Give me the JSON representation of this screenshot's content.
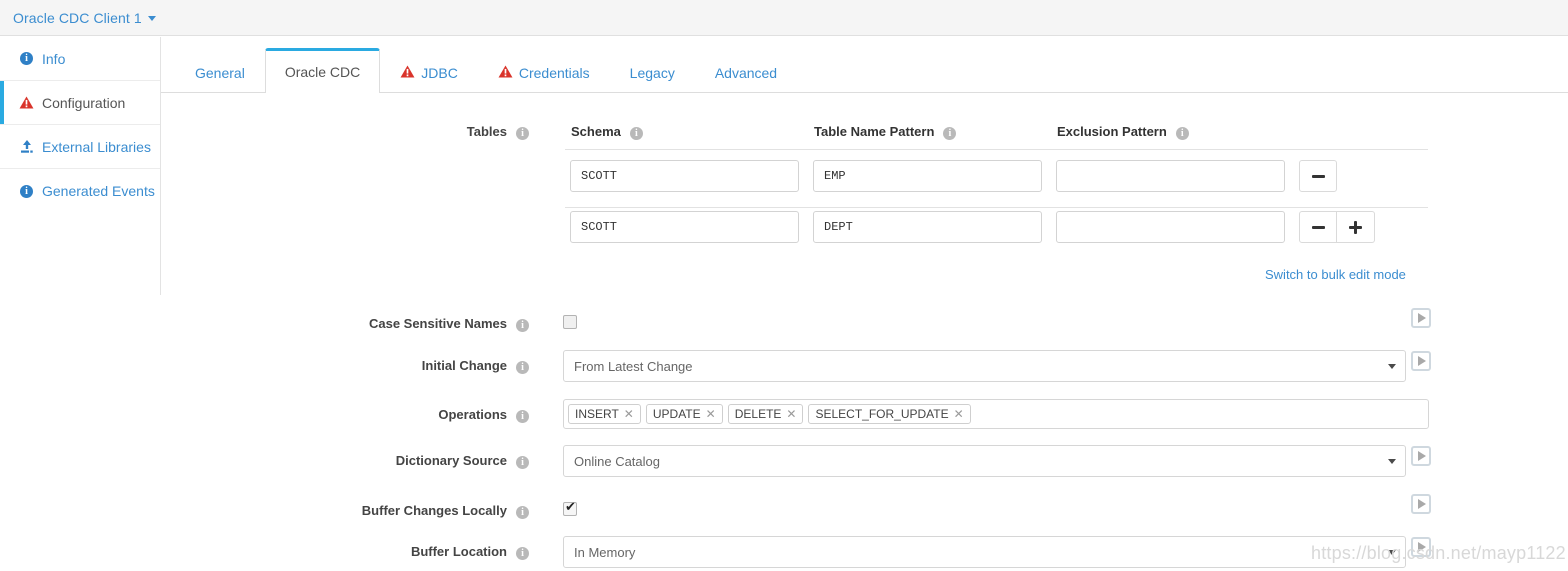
{
  "titlebar": {
    "title": "Oracle CDC Client 1",
    "caret_icon": "chevron-down-icon"
  },
  "sidebar": {
    "items": [
      {
        "label": "Info",
        "icon": "info-circle-icon",
        "active": false
      },
      {
        "label": "Configuration",
        "icon": "warning-triangle-icon",
        "active": true
      },
      {
        "label": "External Libraries",
        "icon": "upload-icon",
        "active": false
      },
      {
        "label": "Generated Events",
        "icon": "info-circle-icon",
        "active": false
      }
    ]
  },
  "tabs": [
    {
      "label": "General",
      "icon": null,
      "active": false
    },
    {
      "label": "Oracle CDC",
      "icon": null,
      "active": true
    },
    {
      "label": "JDBC",
      "icon": "warning-triangle-icon",
      "active": false
    },
    {
      "label": "Credentials",
      "icon": "warning-triangle-icon",
      "active": false
    },
    {
      "label": "Legacy",
      "icon": null,
      "active": false
    },
    {
      "label": "Advanced",
      "icon": null,
      "active": false
    }
  ],
  "form": {
    "tables": {
      "label": "Tables",
      "info_icon": "info-circle-icon",
      "columns": [
        {
          "label": "Schema",
          "info_icon": "info-circle-icon"
        },
        {
          "label": "Table Name Pattern",
          "info_icon": "info-circle-icon"
        },
        {
          "label": "Exclusion Pattern",
          "info_icon": "info-circle-icon"
        }
      ],
      "rows": [
        {
          "schema": "SCOTT",
          "table_name_pattern": "EMP",
          "exclusion_pattern": "",
          "buttons": [
            "minus"
          ]
        },
        {
          "schema": "SCOTT",
          "table_name_pattern": "DEPT",
          "exclusion_pattern": "",
          "buttons": [
            "minus",
            "plus"
          ]
        }
      ],
      "bulk_edit_link": "Switch to bulk edit mode"
    },
    "case_sensitive_names": {
      "label": "Case Sensitive Names",
      "info_icon": "info-circle-icon",
      "checked": false,
      "expand_icon": "play-expand-icon"
    },
    "initial_change": {
      "label": "Initial Change",
      "info_icon": "info-circle-icon",
      "value": "From Latest Change",
      "caret_icon": "chevron-down-icon",
      "expand_icon": "play-expand-icon"
    },
    "operations": {
      "label": "Operations",
      "info_icon": "info-circle-icon",
      "tags": [
        "INSERT",
        "UPDATE",
        "DELETE",
        "SELECT_FOR_UPDATE"
      ],
      "tag_remove_icon": "close-icon"
    },
    "dictionary_source": {
      "label": "Dictionary Source",
      "info_icon": "info-circle-icon",
      "value": "Online Catalog",
      "caret_icon": "chevron-down-icon",
      "expand_icon": "play-expand-icon"
    },
    "buffer_changes_locally": {
      "label": "Buffer Changes Locally",
      "info_icon": "info-circle-icon",
      "checked": true,
      "expand_icon": "play-expand-icon"
    },
    "buffer_location": {
      "label": "Buffer Location",
      "info_icon": "info-circle-icon",
      "value": "In Memory",
      "caret_icon": "chevron-down-icon",
      "expand_icon": "play-expand-icon"
    }
  },
  "watermark": "https://blog.csdn.net/mayp1122",
  "colors": {
    "accent": "#2aaae1",
    "link": "#3b8dd0",
    "warning": "#d9342b",
    "info": "#2f80c6",
    "titlebar_bg": "#f5f5f5"
  }
}
